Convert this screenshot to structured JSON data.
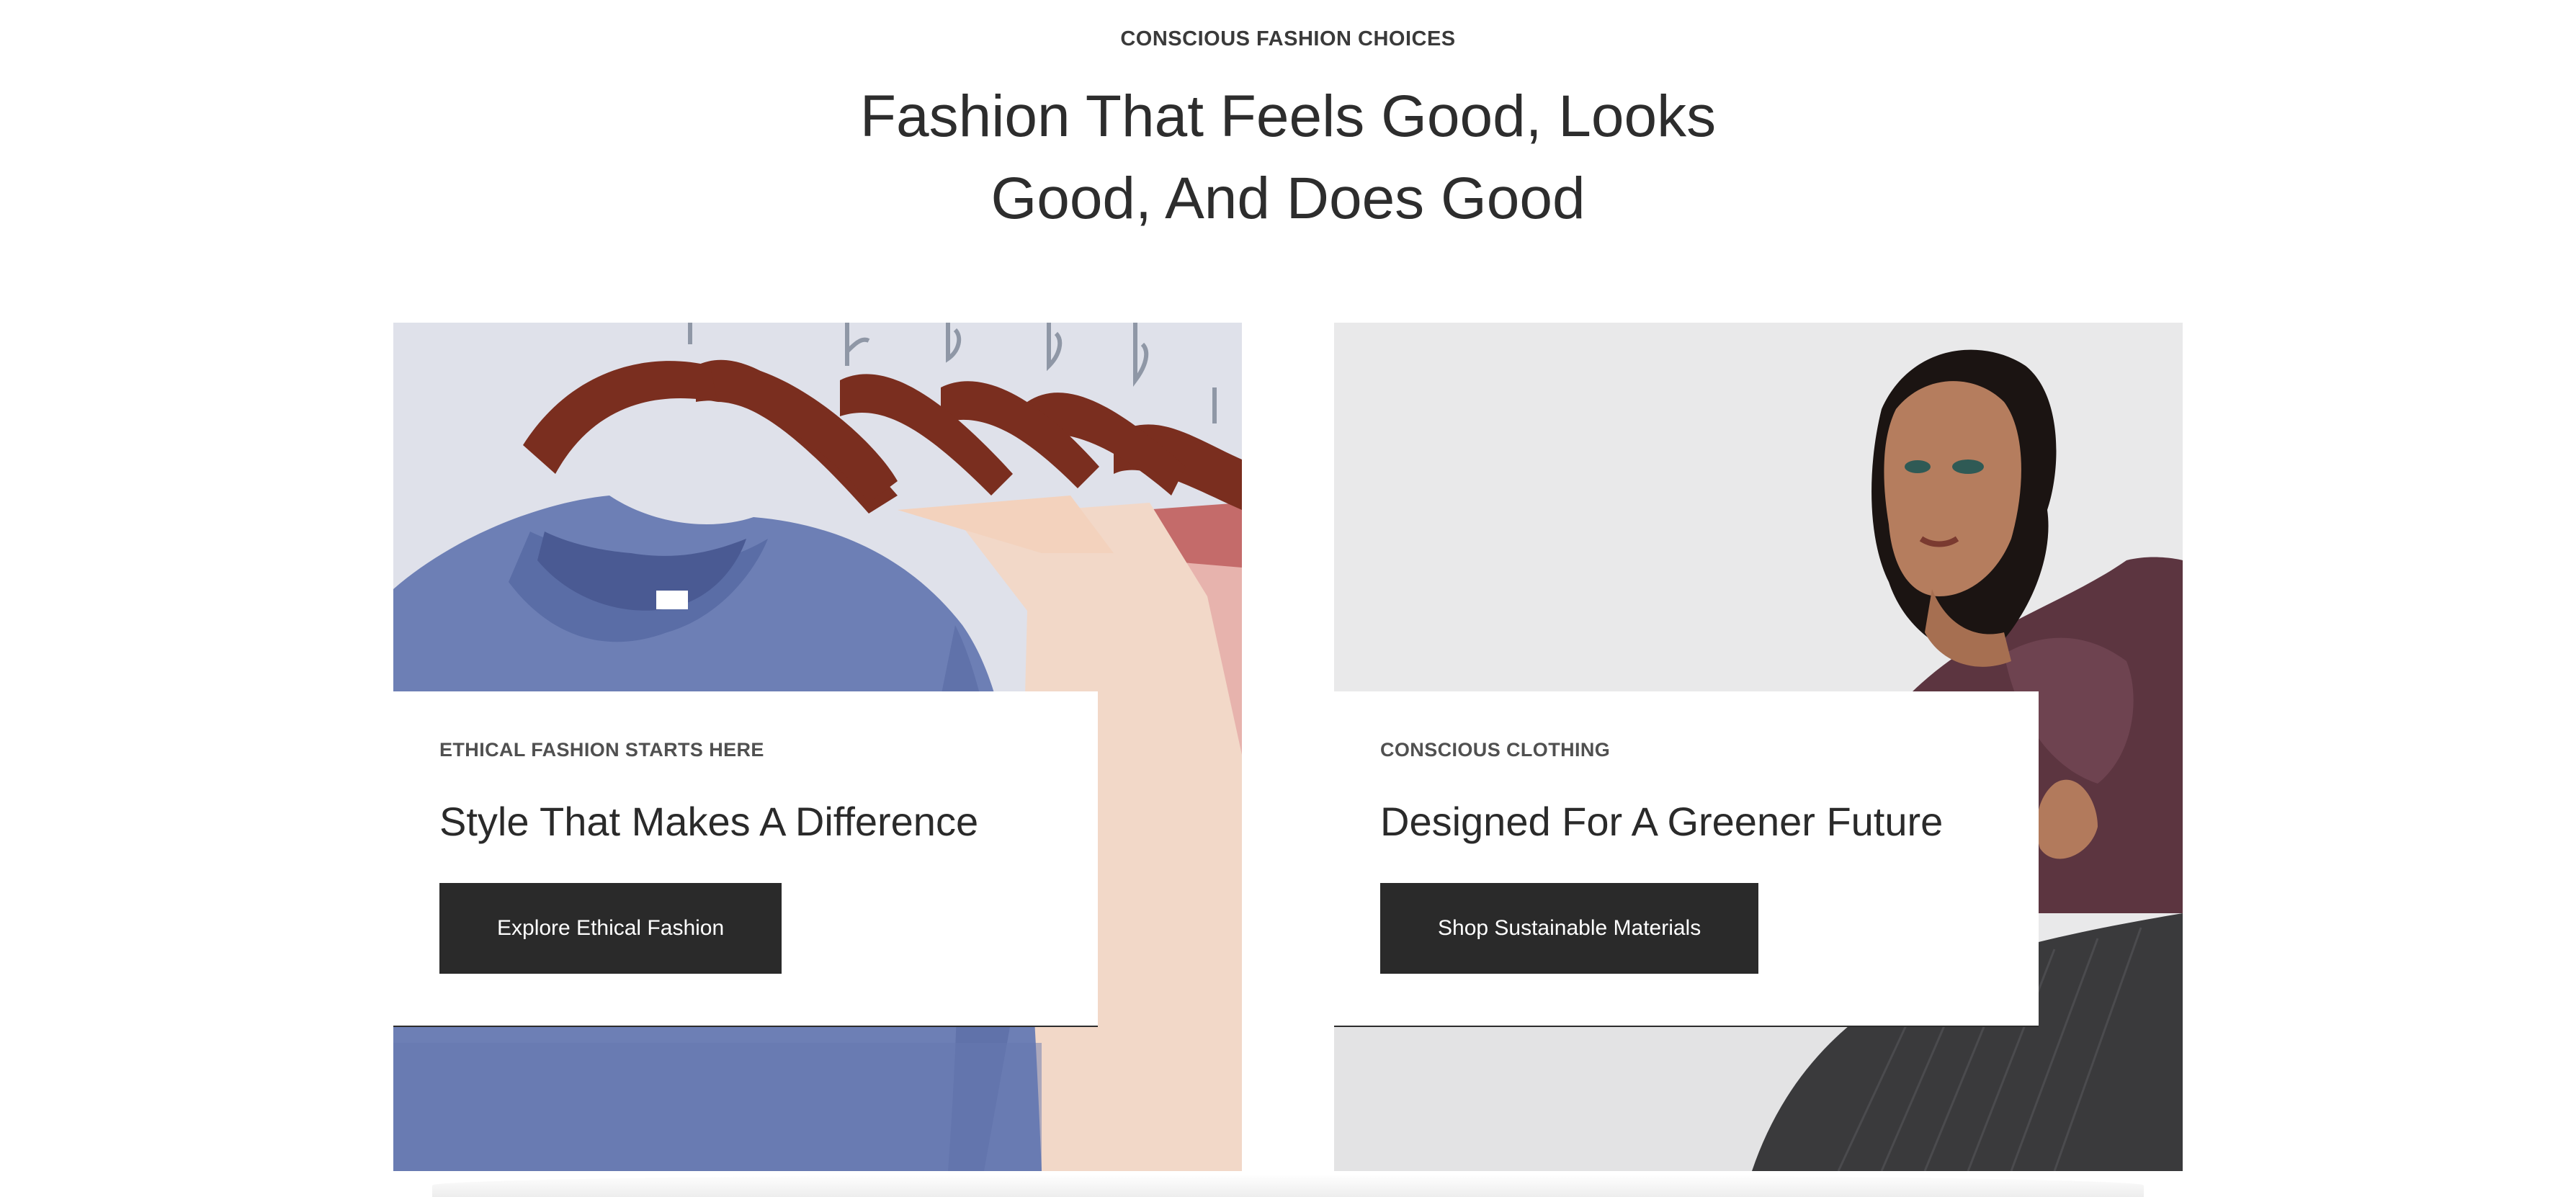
{
  "section": {
    "eyebrow": "CONSCIOUS FASHION CHOICES",
    "headline_line1": "Fashion That Feels Good, Looks",
    "headline_line2": "Good, And Does Good"
  },
  "cards": [
    {
      "image": "shirts-on-hangers",
      "eyebrow": "ETHICAL FASHION STARTS HERE",
      "title": "Style That Makes A Difference",
      "button_label": "Explore Ethical Fashion"
    },
    {
      "image": "model-portrait",
      "eyebrow": "CONSCIOUS CLOTHING",
      "title": "Designed For A Greener Future",
      "button_label": "Shop Sustainable Materials"
    }
  ],
  "colors": {
    "text": "#2b2b2b",
    "button_bg": "#2a2a2a",
    "button_text": "#ffffff",
    "background": "#ffffff"
  }
}
